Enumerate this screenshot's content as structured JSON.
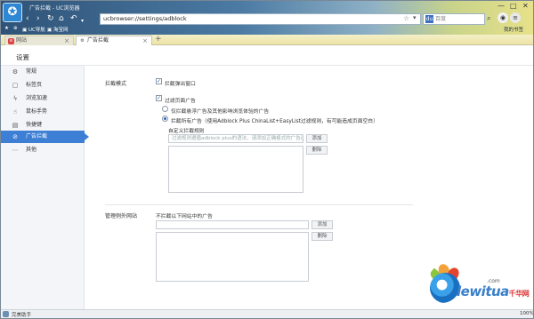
{
  "window": {
    "title": "广告拦截 - UC浏览器",
    "address": "ucbrowser://settings/adblock",
    "search_placeholder": "百度",
    "controls": [
      "—",
      "□",
      "✕"
    ]
  },
  "bookmarks": {
    "items": [
      "UC导航",
      "淘宝网"
    ],
    "right_label": "我的书签"
  },
  "tabs": [
    {
      "label": "网站",
      "active": false
    },
    {
      "label": "广告拦截",
      "active": true
    }
  ],
  "page": {
    "title": "设置"
  },
  "sidebar": {
    "items": [
      {
        "label": "常规",
        "icon": "gear-icon",
        "glyph": "⚙",
        "active": false
      },
      {
        "label": "标签页",
        "icon": "tab-icon",
        "glyph": "▢",
        "active": false
      },
      {
        "label": "浏览加速",
        "icon": "lightning-icon",
        "glyph": "ϟ",
        "active": false
      },
      {
        "label": "鼠标手势",
        "icon": "mouse-icon",
        "glyph": "☝",
        "active": false
      },
      {
        "label": "快捷键",
        "icon": "keyboard-icon",
        "glyph": "▤",
        "active": false
      },
      {
        "label": "广告拦截",
        "icon": "block-icon",
        "glyph": "⊘",
        "active": true
      },
      {
        "label": "其他",
        "icon": "more-icon",
        "glyph": "⋯",
        "active": false
      }
    ]
  },
  "adblock": {
    "section_label": "拦截模式",
    "popup_checkbox": {
      "label": "拦截弹出窗口",
      "checked": true
    },
    "page_ads_checkbox": {
      "label": "过滤页面广告",
      "checked": true
    },
    "radio_light": {
      "label": "仅拦截悬浮广告及其他影响浏览体验的广告",
      "selected": false
    },
    "radio_all": {
      "label": "拦截所有广告（使用Adblock Plus ChinaList+EasyList过滤规则，有可能造成页面空白）",
      "selected": true
    },
    "custom_rules_label": "自定义拦截规则",
    "rule_input_placeholder": "过滤规则遵循adblock plus的语法，请添加正确格式的广告过滤规则",
    "add_button": "添加",
    "delete_button": "删除"
  },
  "exceptions": {
    "section_label": "管理例外网站",
    "description": "不拦截以下网站中的广告",
    "add_button": "添加",
    "delete_button": "删除"
  },
  "status": {
    "left": "完美助手",
    "zoom": "100%"
  },
  "watermark": {
    "brand": "lewitua",
    "chinese": "千华网",
    "dotcom": ".com"
  }
}
